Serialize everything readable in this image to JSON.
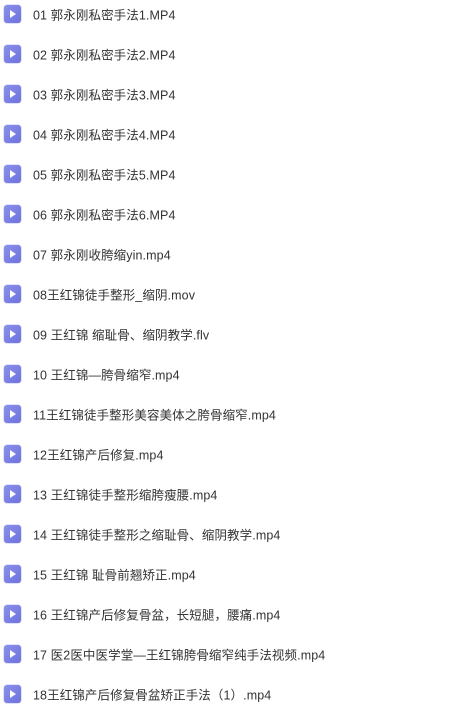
{
  "files": [
    {
      "name": "01 郭永刚私密手法1.MP4",
      "icon": "video-file-icon"
    },
    {
      "name": "02 郭永刚私密手法2.MP4",
      "icon": "video-file-icon"
    },
    {
      "name": "03 郭永刚私密手法3.MP4",
      "icon": "video-file-icon"
    },
    {
      "name": "04 郭永刚私密手法4.MP4",
      "icon": "video-file-icon"
    },
    {
      "name": "05 郭永刚私密手法5.MP4",
      "icon": "video-file-icon"
    },
    {
      "name": "06 郭永刚私密手法6.MP4",
      "icon": "video-file-icon"
    },
    {
      "name": "07 郭永刚收胯缩yin.mp4",
      "icon": "video-file-icon"
    },
    {
      "name": "08王红锦徒手整形_缩阴.mov",
      "icon": "video-file-icon"
    },
    {
      "name": "09 王红锦 缩耻骨、缩阴教学.flv",
      "icon": "video-file-icon"
    },
    {
      "name": "10 王红锦—胯骨缩窄.mp4",
      "icon": "video-file-icon"
    },
    {
      "name": "11王红锦徒手整形美容美体之胯骨缩窄.mp4",
      "icon": "video-file-icon"
    },
    {
      "name": "12王红锦产后修复.mp4",
      "icon": "video-file-icon"
    },
    {
      "name": "13 王红锦徒手整形缩胯瘦腰.mp4",
      "icon": "video-file-icon"
    },
    {
      "name": "14 王红锦徒手整形之缩耻骨、缩阴教学.mp4",
      "icon": "video-file-icon"
    },
    {
      "name": "15 王红锦 耻骨前翘矫正.mp4",
      "icon": "video-file-icon"
    },
    {
      "name": "16 王红锦产后修复骨盆，长短腿，腰痛.mp4",
      "icon": "video-file-icon"
    },
    {
      "name": "17 医2医中医学堂—王红锦胯骨缩窄纯手法视频.mp4",
      "icon": "video-file-icon"
    },
    {
      "name": "18王红锦产后修复骨盆矫正手法（1）.mp4",
      "icon": "video-file-icon"
    }
  ],
  "colors": {
    "icon": "#7a80e4",
    "text": "#333333",
    "background": "#ffffff"
  }
}
